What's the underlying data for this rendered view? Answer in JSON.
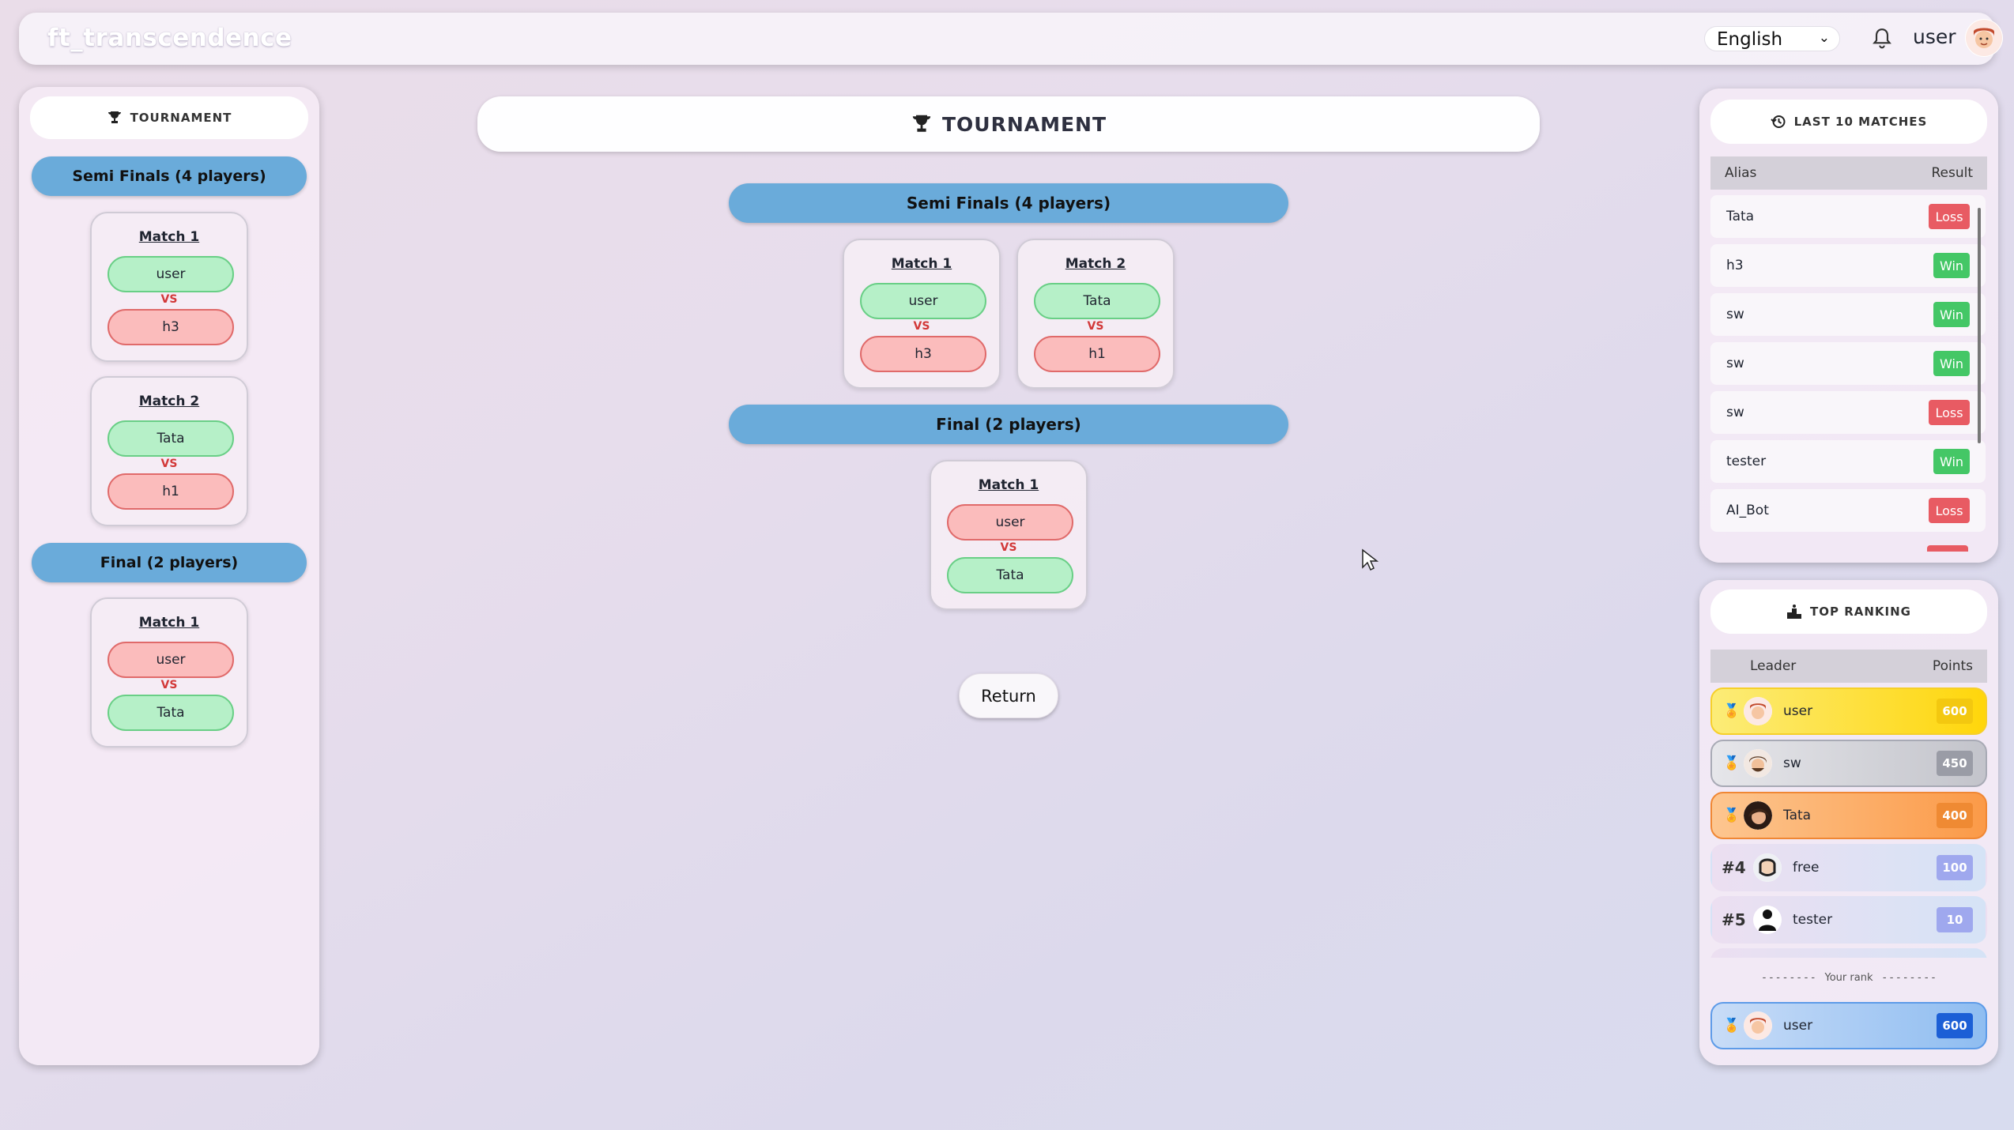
{
  "app": {
    "logo": "ft_transcendence"
  },
  "header": {
    "language": "English",
    "username": "user"
  },
  "sidebar": {
    "title": "TOURNAMENT",
    "stages": [
      {
        "label": "Semi Finals (4 players)"
      },
      {
        "label": "Final (2 players)"
      }
    ],
    "matches": [
      {
        "label": "Match 1",
        "p1": "user",
        "p2": "h3"
      },
      {
        "label": "Match 2",
        "p1": "Tata",
        "p2": "h1"
      },
      {
        "label": "Match 1",
        "p1": "user",
        "p2": "Tata"
      }
    ]
  },
  "main": {
    "title": "TOURNAMENT",
    "stages": [
      {
        "label": "Semi Finals (4 players)"
      },
      {
        "label": "Final (2 players)"
      }
    ],
    "matches": [
      {
        "label": "Match 1",
        "p1": "user",
        "p2": "h3"
      },
      {
        "label": "Match 2",
        "p1": "Tata",
        "p2": "h1"
      },
      {
        "label": "Match 1",
        "p1": "user",
        "p2": "Tata"
      }
    ],
    "vs": "VS",
    "return_label": "Return"
  },
  "last_matches": {
    "title": "LAST 10 MATCHES",
    "col_alias": "Alias",
    "col_result": "Result",
    "rows": [
      {
        "alias": "Tata",
        "result": "Loss"
      },
      {
        "alias": "h3",
        "result": "Win"
      },
      {
        "alias": "sw",
        "result": "Win"
      },
      {
        "alias": "sw",
        "result": "Win"
      },
      {
        "alias": "sw",
        "result": "Loss"
      },
      {
        "alias": "tester",
        "result": "Win"
      },
      {
        "alias": "AI_Bot",
        "result": "Loss"
      }
    ]
  },
  "ranking": {
    "title": "TOP RANKING",
    "col_leader": "Leader",
    "col_points": "Points",
    "rows": [
      {
        "rank": "1",
        "name": "user",
        "points": "600"
      },
      {
        "rank": "2",
        "name": "sw",
        "points": "450"
      },
      {
        "rank": "3",
        "name": "Tata",
        "points": "400"
      },
      {
        "rank": "#4",
        "name": "free",
        "points": "100"
      },
      {
        "rank": "#5",
        "name": "tester",
        "points": "10"
      }
    ],
    "your_rank_label": "Your rank",
    "your_row": {
      "name": "user",
      "points": "600"
    }
  },
  "colors": {
    "win": "#b6f0c8",
    "loss": "#fbbcbc",
    "stage": "#6aabda",
    "win_badge": "#44c766",
    "loss_badge": "#e85b63"
  }
}
